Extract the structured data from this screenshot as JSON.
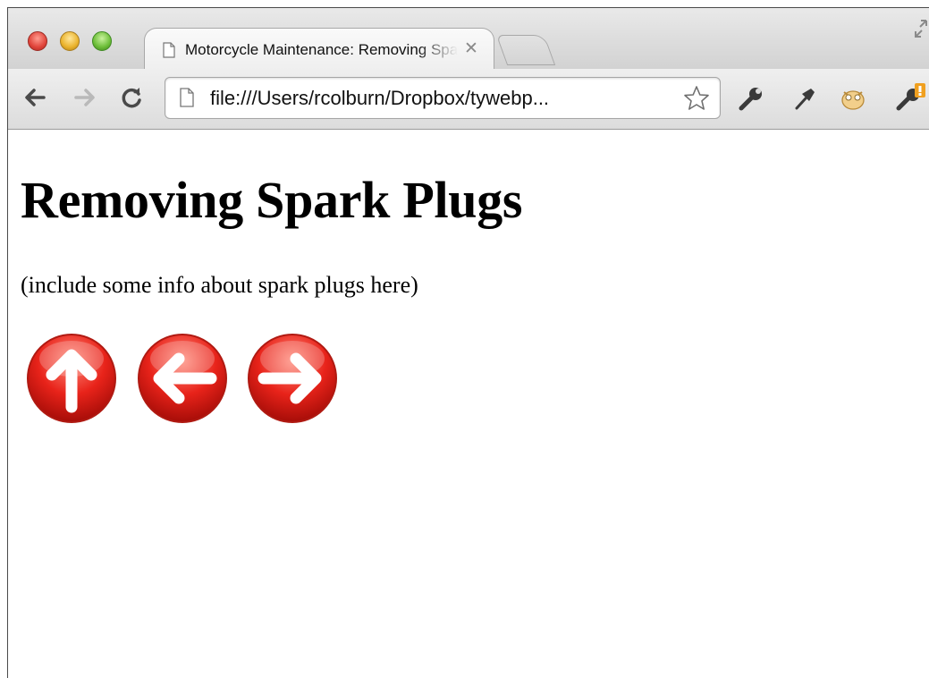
{
  "browser": {
    "tab": {
      "title": "Motorcycle Maintenance: Removing Spark Plugs",
      "close_glyph": "✕"
    },
    "address_bar": {
      "url": "file:///Users/rcolburn/Dropbox/tywebp..."
    }
  },
  "page": {
    "heading": "Removing Spark Plugs",
    "paragraph": "(include some info about spark plugs here)",
    "nav_icons": [
      "up-arrow-icon",
      "left-arrow-icon",
      "right-arrow-icon"
    ]
  },
  "colors": {
    "nav_icon_red": "#e8231a",
    "nav_icon_highlight": "#ff8a7a"
  }
}
